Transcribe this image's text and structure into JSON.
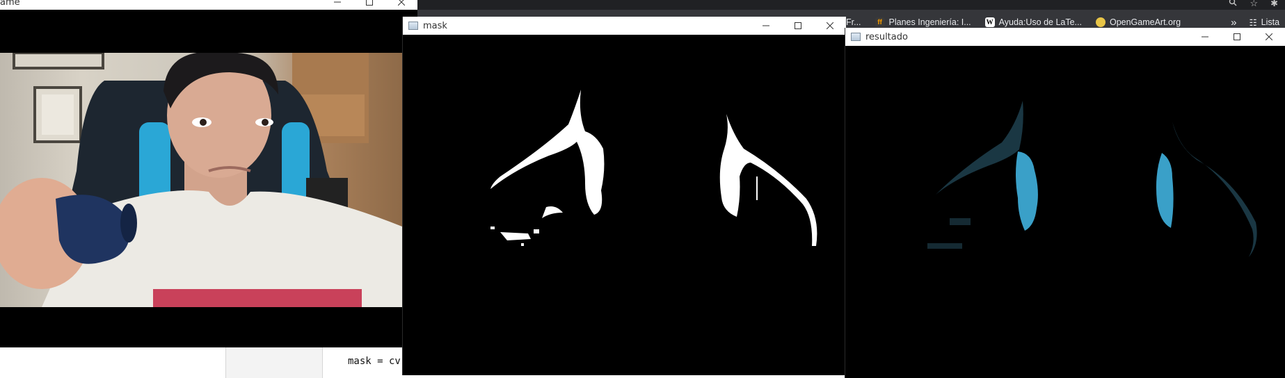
{
  "screen": {
    "width": 1847,
    "height": 544
  },
  "browser": {
    "bookmarks": [
      {
        "label": "Fr...",
        "icon": "generic-bookmark-icon",
        "color": "#5f6368"
      },
      {
        "label": "Planes Ingeniería: I...",
        "icon": "bookmark-favicon-icon",
        "color": "#f29900"
      },
      {
        "label": "Ayuda:Uso de LaTe...",
        "icon": "wikipedia-w-icon",
        "color": "#ffffff"
      },
      {
        "label": "OpenGameArt.org",
        "icon": "opengameart-icon",
        "color": "#e8c547"
      }
    ],
    "overflow_label": "»",
    "reading_list_label": "Lista"
  },
  "editor": {
    "code_line": "mask = cv"
  },
  "windows": {
    "frame": {
      "title": "ame"
    },
    "mask": {
      "title": "mask"
    },
    "resultado": {
      "title": "resultado"
    }
  },
  "colors": {
    "mask_white": "#ffffff",
    "result_blue": "#3aa0c8",
    "titlebar_bg": "#ffffff",
    "browser_bg": "#35363a"
  }
}
